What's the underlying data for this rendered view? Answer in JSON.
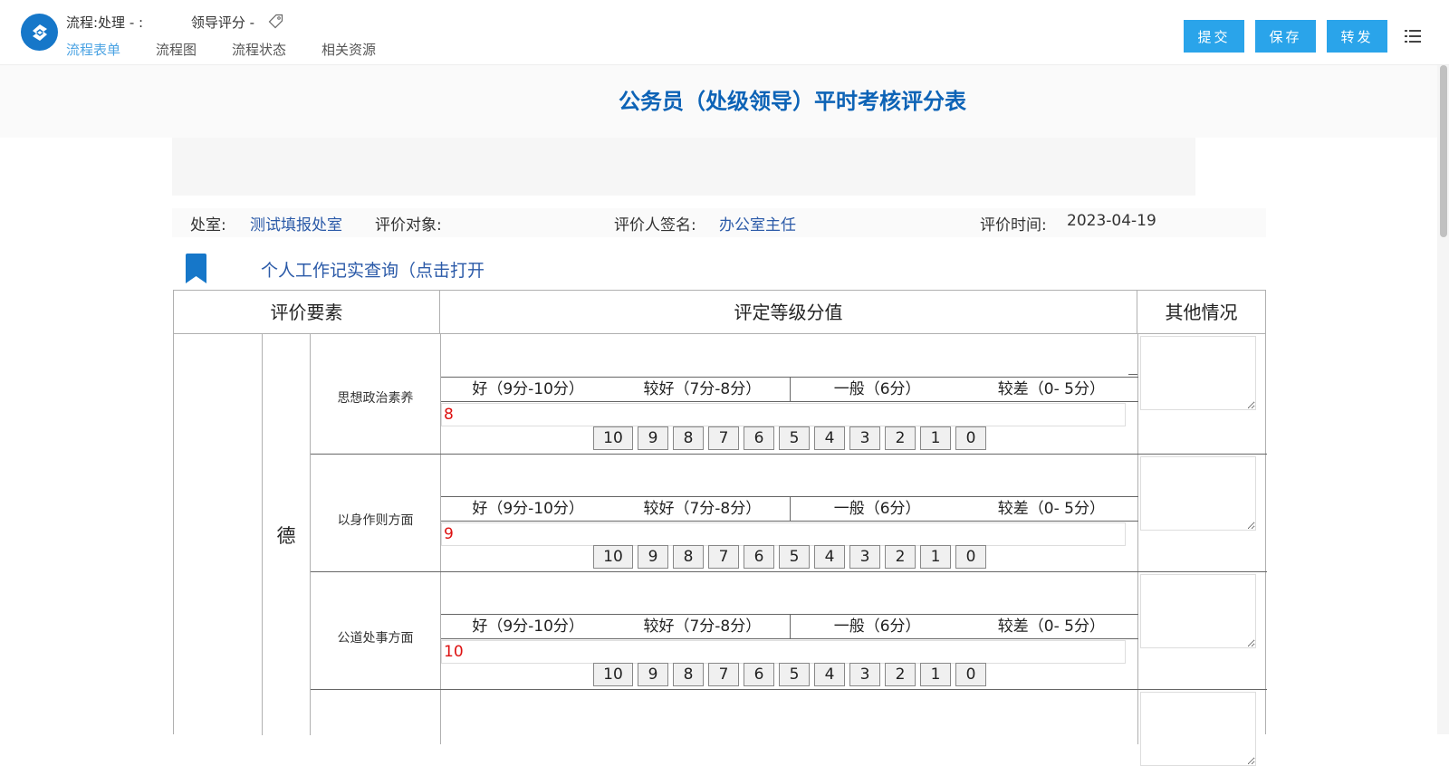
{
  "header": {
    "process_label": "流程:处理 - :",
    "process_sub": "领导评分 -",
    "tabs": [
      "流程表单",
      "流程图",
      "流程状态",
      "相关资源"
    ],
    "active_tab": 0,
    "buttons": {
      "submit": "提交",
      "save": "保存",
      "forward": "转发"
    }
  },
  "form": {
    "title": "公务员（处级领导）平时考核评分表",
    "info": {
      "dept_label": "处室:",
      "dept_value": "测试填报处室",
      "target_label": "评价对象:",
      "signer_label": "评价人签名:",
      "signer_value": "办公室主任",
      "time_label": "评价时间:",
      "time_value": "2023-04-19"
    },
    "record_link": "个人工作记实查询（点击打开",
    "table": {
      "headers": [
        "评价要素",
        "评定等级分值",
        "其他情况"
      ],
      "category": "德",
      "grade_labels": [
        "好（9分-10分）",
        "较好（7分-8分）",
        "一般（6分）",
        "较差（0- 5分）"
      ],
      "score_buttons": [
        "10",
        "9",
        "8",
        "7",
        "6",
        "5",
        "4",
        "3",
        "2",
        "1",
        "0"
      ],
      "rows": [
        {
          "label": "思想政治素养",
          "score": "8"
        },
        {
          "label": "以身作则方面",
          "score": "9"
        },
        {
          "label": "公道处事方面",
          "score": "10"
        }
      ]
    }
  },
  "colors": {
    "accent": "#2aa4ea",
    "title": "#0d63b6",
    "link": "#2b5aa8",
    "score": "#dd1111"
  }
}
